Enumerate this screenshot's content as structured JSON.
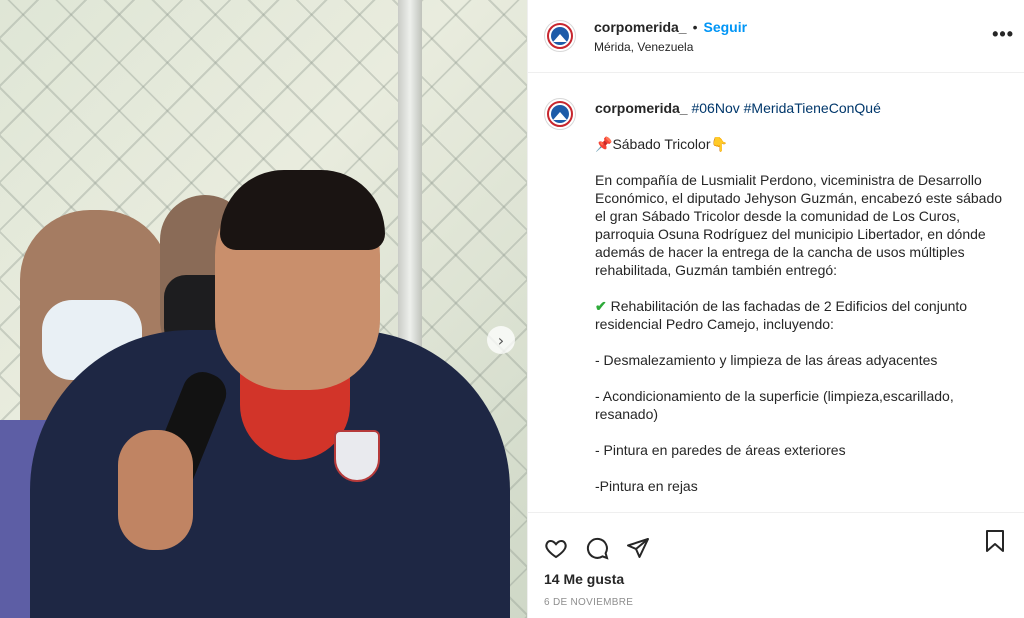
{
  "post": {
    "username": "corpomerida_",
    "follow_label": "Seguir",
    "separator": "•",
    "location": "Mérida, Venezuela",
    "more_label": "•••",
    "next_arrow": "›",
    "caption": {
      "username": "corpomerida_",
      "hashtags": "#06Nov #MeridaTieneConQué",
      "pin_icon": "📌",
      "title_text": "Sábado Tricolor",
      "point_icon": "👇",
      "paragraph": "En compañía de Lusmialit Perdono, viceministra de Desarrollo Económico, el diputado Jehyson Guzmán, encabezó este sábado el gran Sábado Tricolor desde la comunidad de Los Curos, parroquia Osuna Rodríguez del municipio Libertador, en dónde además de hacer la entrega de la cancha de usos múltiples rehabilitada, Guzmán también entregó:",
      "check_icon": "✔",
      "check_text": "Rehabilitación de las fachadas de 2 Edificios del conjunto residencial Pedro Camejo, incluyendo:",
      "items": [
        "- Desmalezamiento y limpieza de las áreas adyacentes",
        "- Acondicionamiento de la superficie (limpieza,escarillado, resanado)",
        "- Pintura en paredes de áreas exteriores",
        "-Pintura en rejas"
      ]
    },
    "actions": {
      "like_icon": "heart-icon",
      "comment_icon": "comment-icon",
      "share_icon": "share-icon",
      "save_icon": "bookmark-icon"
    },
    "likes": "14 Me gusta",
    "date": "6 DE NOVIEMBRE"
  },
  "colors": {
    "follow": "#0095f6",
    "hashtag": "#00376b",
    "text": "#262626",
    "muted": "#8e8e8e",
    "border": "#efefef"
  }
}
